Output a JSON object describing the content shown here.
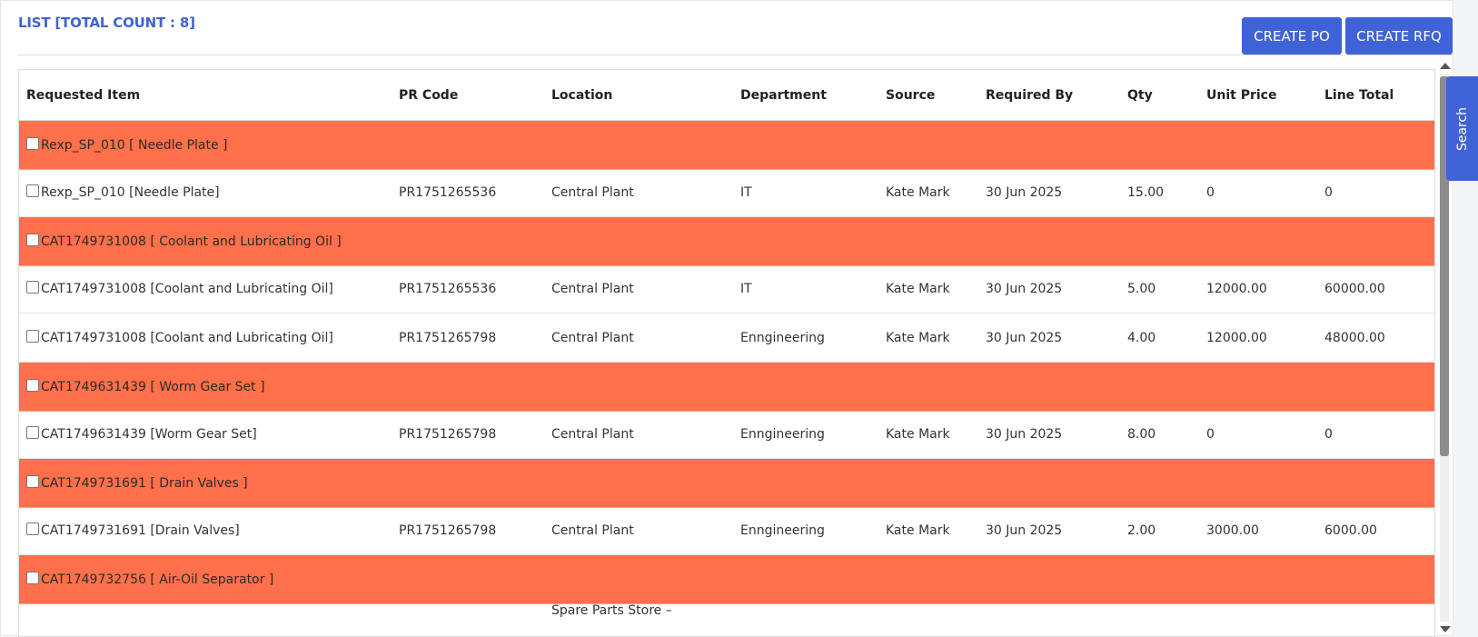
{
  "header": {
    "title": "LIST [TOTAL COUNT : 8]",
    "create_po": "CREATE PO",
    "create_rfq": "CREATE RFQ"
  },
  "table": {
    "columns": [
      "Requested Item",
      "PR Code",
      "Location",
      "Department",
      "Source",
      "Required By",
      "Qty",
      "Unit Price",
      "Line Total"
    ],
    "rows": [
      {
        "type": "group",
        "item": "Rexp_SP_010 [ Needle Plate ]"
      },
      {
        "type": "data",
        "item": "Rexp_SP_010 [Needle Plate]",
        "pr": "PR1751265536",
        "location": "Central Plant",
        "dept": "IT",
        "source": "Kate Mark",
        "required": "30 Jun 2025",
        "qty": "15.00",
        "unit": "0",
        "total": "0"
      },
      {
        "type": "group",
        "item": "CAT1749731008 [ Coolant and Lubricating Oil ]"
      },
      {
        "type": "data",
        "item": "CAT1749731008 [Coolant and Lubricating Oil]",
        "pr": "PR1751265536",
        "location": "Central Plant",
        "dept": "IT",
        "source": "Kate Mark",
        "required": "30 Jun 2025",
        "qty": "5.00",
        "unit": "12000.00",
        "total": "60000.00"
      },
      {
        "type": "data",
        "item": "CAT1749731008 [Coolant and Lubricating Oil]",
        "pr": "PR1751265798",
        "location": "Central Plant",
        "dept": "Enngineering",
        "source": "Kate Mark",
        "required": "30 Jun 2025",
        "qty": "4.00",
        "unit": "12000.00",
        "total": "48000.00"
      },
      {
        "type": "group",
        "item": "CAT1749631439 [ Worm Gear Set ]"
      },
      {
        "type": "data",
        "item": "CAT1749631439 [Worm Gear Set]",
        "pr": "PR1751265798",
        "location": "Central Plant",
        "dept": "Enngineering",
        "source": "Kate Mark",
        "required": "30 Jun 2025",
        "qty": "8.00",
        "unit": "0",
        "total": "0"
      },
      {
        "type": "group",
        "item": "CAT1749731691 [ Drain Valves ]"
      },
      {
        "type": "data",
        "item": "CAT1749731691 [Drain Valves]",
        "pr": "PR1751265798",
        "location": "Central Plant",
        "dept": "Enngineering",
        "source": "Kate Mark",
        "required": "30 Jun 2025",
        "qty": "2.00",
        "unit": "3000.00",
        "total": "6000.00"
      },
      {
        "type": "group",
        "item": "CAT1749732756 [ Air-Oil Separator ]"
      },
      {
        "type": "data",
        "item": "",
        "pr": "",
        "location": "Spare Parts Store –",
        "dept": "",
        "source": "",
        "required": "",
        "qty": "",
        "unit": "",
        "total": ""
      }
    ]
  },
  "search_tab": "Search",
  "colors": {
    "accent": "#3f63d6",
    "group_row": "#ff704b"
  }
}
